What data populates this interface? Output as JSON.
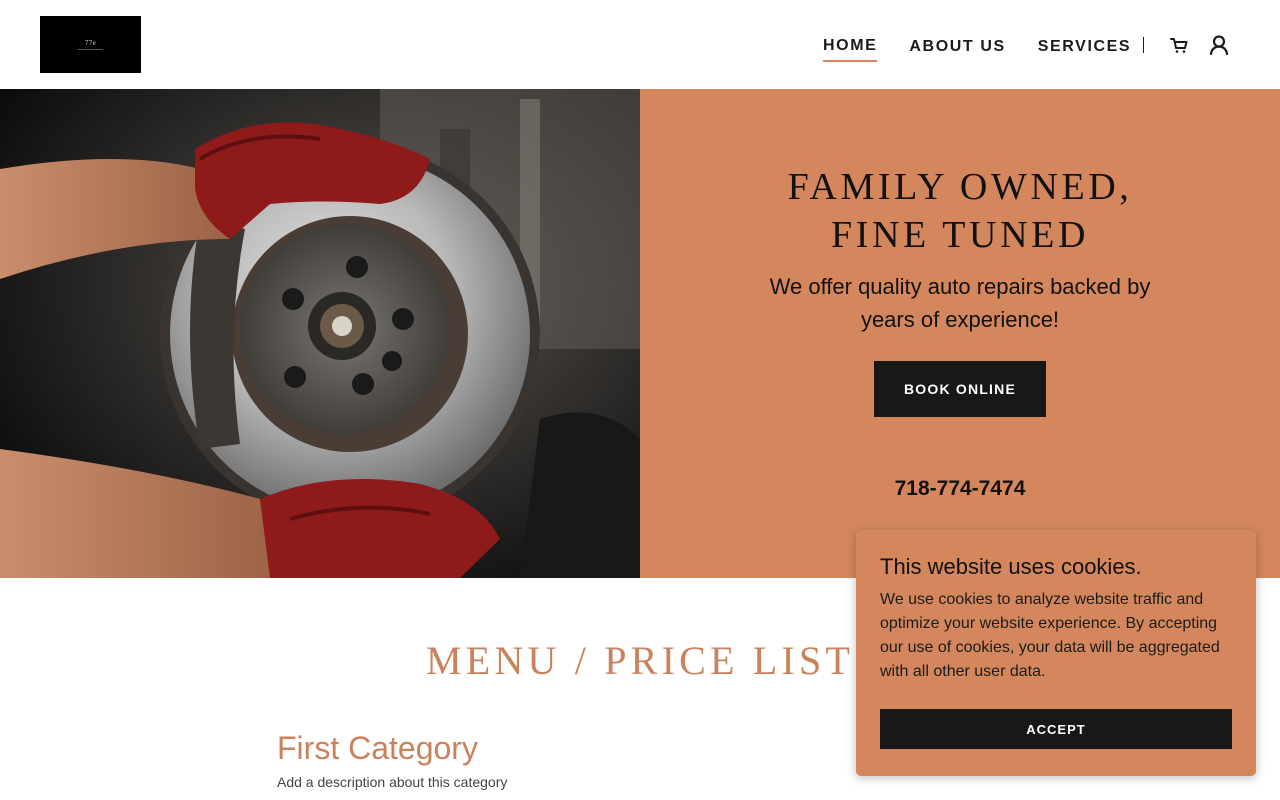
{
  "header": {
    "logo_text": "77e",
    "nav": [
      {
        "label": "HOME",
        "active": true
      },
      {
        "label": "ABOUT US",
        "active": false
      },
      {
        "label": "SERVICES",
        "active": false
      }
    ],
    "icons": [
      "cart-icon",
      "user-icon"
    ]
  },
  "hero": {
    "title_line1": "FAMILY OWNED,",
    "title_line2": "FINE TUNED",
    "subtitle": "We offer quality auto repairs backed by years of experience!",
    "button_label": "BOOK ONLINE",
    "phone": "718-774-7474",
    "image": "brake-rotor-photo"
  },
  "menu": {
    "title": "MENU / PRICE LIST",
    "category_title": "First Category",
    "category_description": "Add a description about this category"
  },
  "cookie_banner": {
    "title": "This website uses cookies.",
    "text": "We use cookies to analyze website traffic and optimize your website experience. By accepting our use of cookies, your data will be aggregated with all other user data.",
    "button_label": "ACCEPT"
  },
  "colors": {
    "accent": "#d4875d",
    "heading_accent": "#c9825b",
    "dark_button": "#181818"
  }
}
